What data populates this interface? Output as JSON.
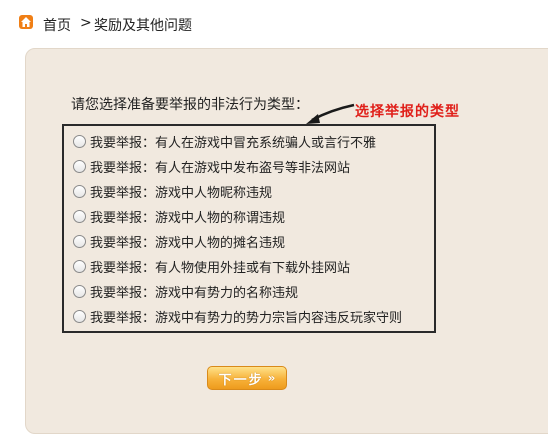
{
  "breadcrumb": {
    "home": "首页",
    "separator": ">",
    "current": "奖励及其他问题"
  },
  "form": {
    "prompt": "请您选择准备要举报的非法行为类型：",
    "annotation": "选择举报的类型",
    "options": [
      "我要举报：有人在游戏中冒充系统骗人或言行不雅",
      "我要举报：有人在游戏中发布盗号等非法网站",
      "我要举报：游戏中人物昵称违规",
      "我要举报：游戏中人物的称谓违规",
      "我要举报：游戏中人物的摊名违规",
      "我要举报：有人物使用外挂或有下载外挂网站",
      "我要举报：游戏中有势力的名称违规",
      "我要举报：游戏中有势力的势力宗旨内容违反玩家守则"
    ],
    "selected_index": null,
    "next_label": "下一步",
    "next_arrow_icon": "double-chevron-right-icon"
  },
  "colors": {
    "panel_bg": "#f1e9df",
    "annotation": "#e0201a",
    "button": "#f7b23a",
    "home_icon": "#f07f16"
  }
}
